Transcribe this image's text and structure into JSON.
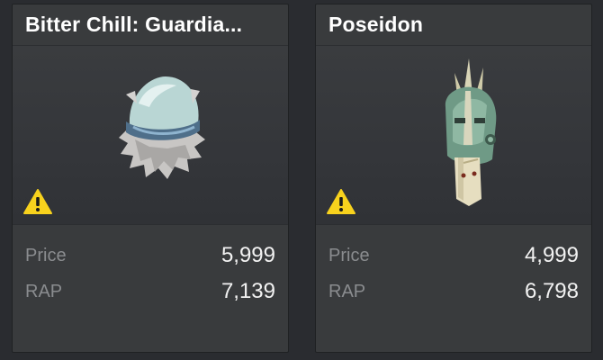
{
  "cards": [
    {
      "title": "Bitter Chill: Guardia...",
      "thumbnail_icon": "ice-helmet-icon",
      "warning_icon": "warning-icon",
      "price_label": "Price",
      "price_value": "5,999",
      "rap_label": "RAP",
      "rap_value": "7,139"
    },
    {
      "title": "Poseidon",
      "thumbnail_icon": "trident-helmet-icon",
      "warning_icon": "warning-icon",
      "price_label": "Price",
      "price_value": "4,999",
      "rap_label": "RAP",
      "rap_value": "6,798"
    }
  ],
  "colors": {
    "card_background": "#393b3d",
    "page_background": "#2a2c30",
    "label_text": "#8a8c8f",
    "value_text": "#f2f2f2",
    "warning_yellow": "#f8d21d"
  }
}
